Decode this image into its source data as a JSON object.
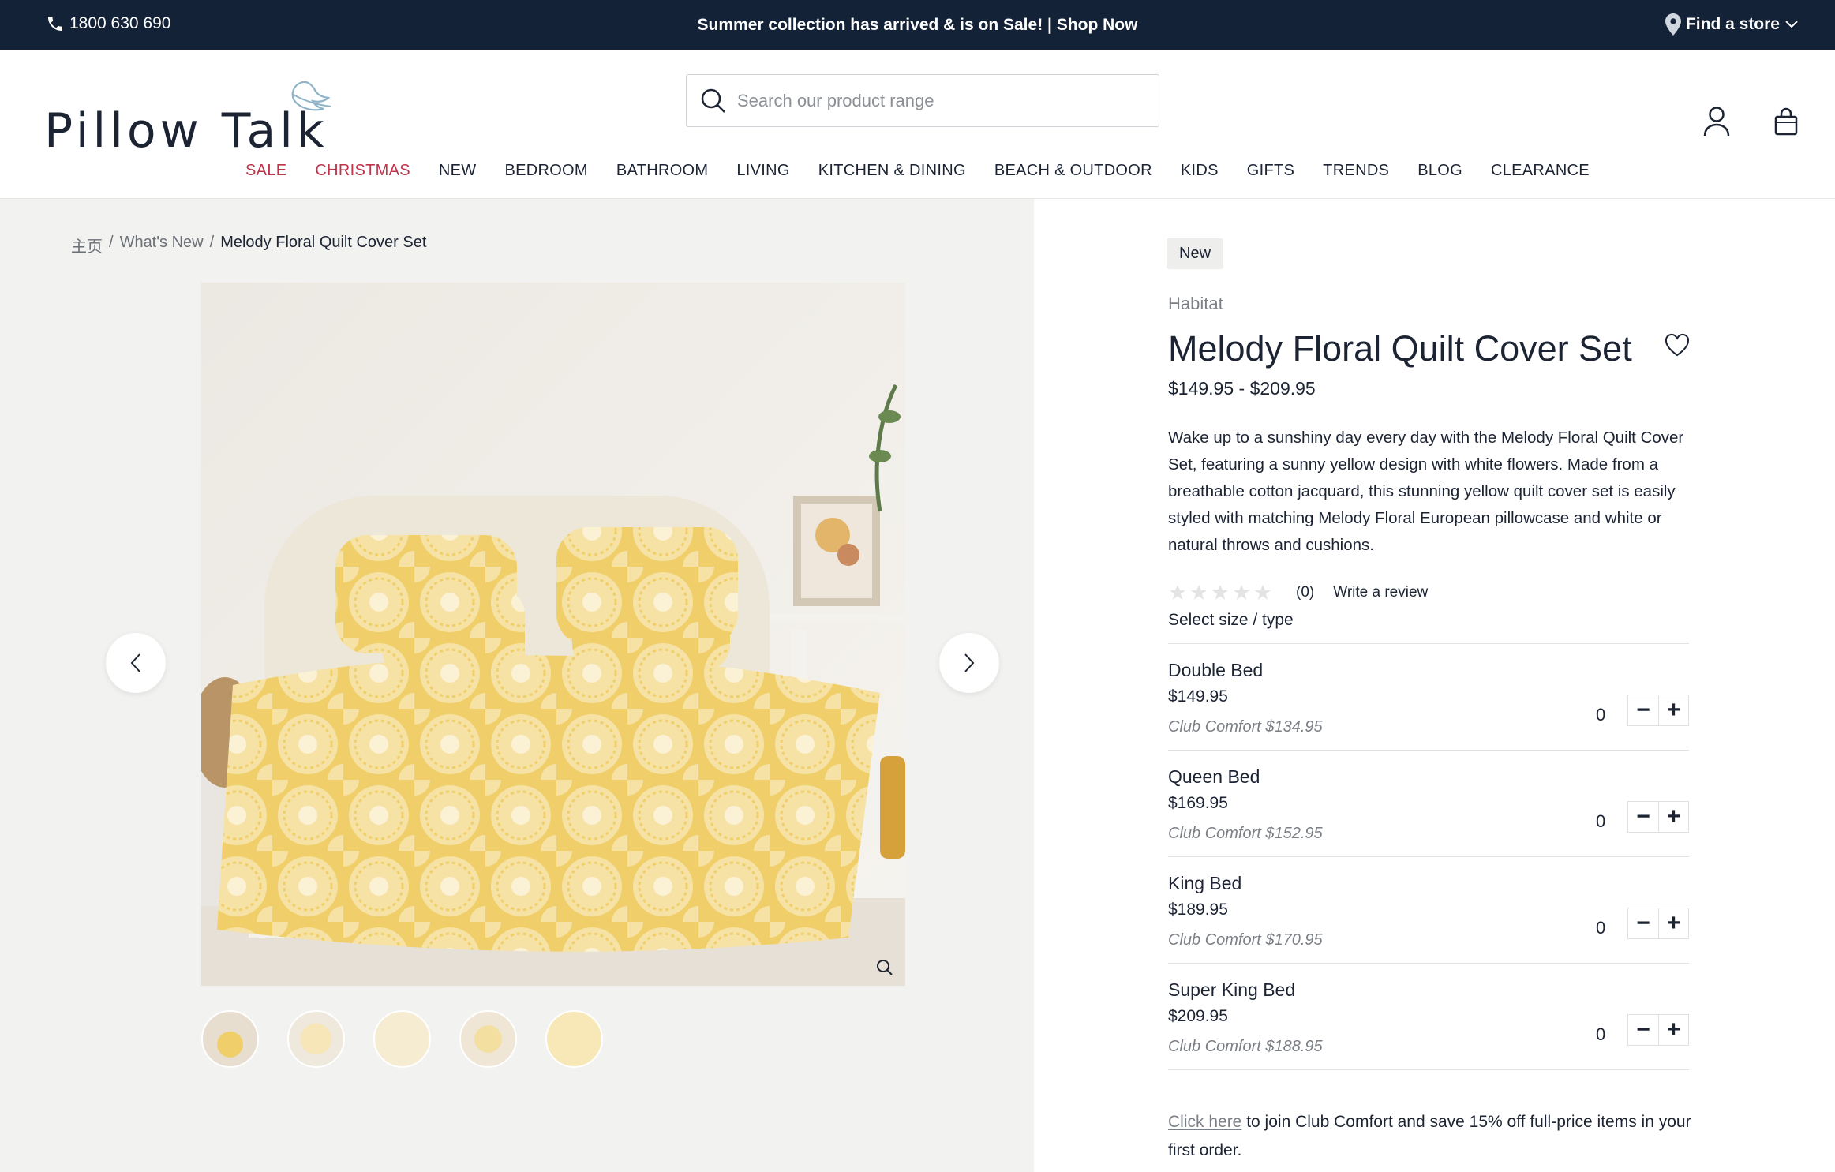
{
  "topbar": {
    "phone": "1800 630 690",
    "promo": "Summer collection has arrived & is on Sale!",
    "promo_sep": "|",
    "promo_link": "Shop Now",
    "store": "Find a store"
  },
  "header": {
    "logo_text": "Pillow Talk",
    "search_placeholder": "Search our product range"
  },
  "nav": [
    {
      "label": "SALE"
    },
    {
      "label": "CHRISTMAS"
    },
    {
      "label": "NEW"
    },
    {
      "label": "BEDROOM"
    },
    {
      "label": "BATHROOM"
    },
    {
      "label": "LIVING"
    },
    {
      "label": "KITCHEN & DINING"
    },
    {
      "label": "BEACH & OUTDOOR"
    },
    {
      "label": "KIDS"
    },
    {
      "label": "GIFTS"
    },
    {
      "label": "TRENDS"
    },
    {
      "label": "BLOG"
    },
    {
      "label": "CLEARANCE"
    }
  ],
  "breadcrumb": {
    "home": "主页",
    "sep": "/",
    "section": "What's New",
    "current": "Melody Floral Quilt Cover Set"
  },
  "product": {
    "badge": "New",
    "brand": "Habitat",
    "title": "Melody Floral Quilt Cover Set",
    "price_range": "$149.95 - $209.95",
    "description": "Wake up to a sunshiny day every day with the Melody Floral Quilt Cover Set, featuring a sunny yellow design with white flowers. Made from a breathable cotton jacquard, this stunning yellow quilt cover set is easily styled with matching Melody Floral European pillowcase and white or natural throws and cushions.",
    "rating_count": "(0)",
    "write_review": "Write a review",
    "select_label": "Select size / type",
    "variants": [
      {
        "name": "Double Bed",
        "price": "$149.95",
        "club": "Club Comfort $134.95",
        "qty": "0"
      },
      {
        "name": "Queen Bed",
        "price": "$169.95",
        "club": "Club Comfort $152.95",
        "qty": "0"
      },
      {
        "name": "King Bed",
        "price": "$189.95",
        "club": "Club Comfort $170.95",
        "qty": "0"
      },
      {
        "name": "Super King Bed",
        "price": "$209.95",
        "club": "Club Comfort $188.95",
        "qty": "0"
      }
    ],
    "stepper_minus": "−",
    "stepper_plus": "+",
    "club_link": "Click here",
    "club_text": " to join Club Comfort and save 15% off full-price items in your first order."
  },
  "colors": {
    "topbar_bg": "#132237",
    "nav_red": "#c0344a",
    "gallery_bg": "#f2f2f0",
    "quilt_yellow": "#f0cf6a"
  }
}
